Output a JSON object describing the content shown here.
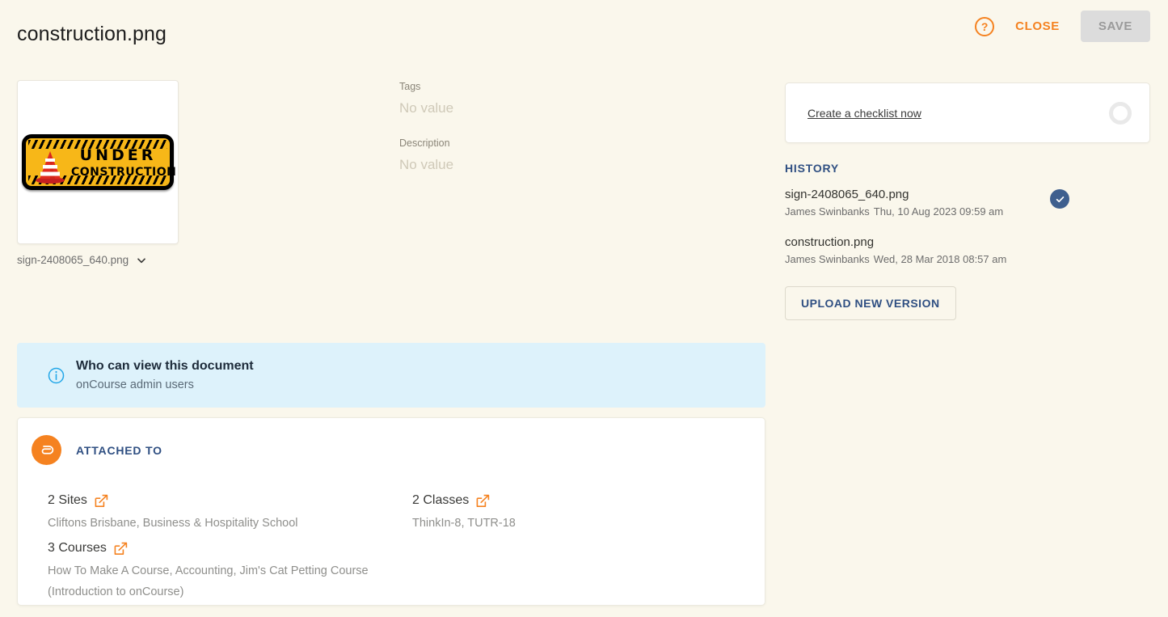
{
  "header": {
    "title": "construction.png",
    "help_icon": "help-circle-icon",
    "help_glyph": "?",
    "close_label": "CLOSE",
    "save_label": "SAVE"
  },
  "preview": {
    "sign_line1": "UNDER",
    "sign_line2": "CONSTRUCTION",
    "caption": "sign-2408065_640.png",
    "caption_chevron": "chevron-down-icon"
  },
  "meta": {
    "tags": {
      "label": "Tags",
      "value": "No value"
    },
    "description": {
      "label": "Description",
      "value": "No value"
    }
  },
  "checklist": {
    "link_label": "Create a checklist now",
    "progress_icon": "progress-ring-icon"
  },
  "history": {
    "title": "HISTORY",
    "items": [
      {
        "filename": "sign-2408065_640.png",
        "author": "James Swinbanks",
        "timestamp": "Thu, 10 Aug 2023 09:59 am",
        "current": true
      },
      {
        "filename": "construction.png",
        "author": "James Swinbanks",
        "timestamp": "Wed, 28 Mar 2018 08:57 am",
        "current": false
      }
    ],
    "upload_label": "UPLOAD NEW VERSION"
  },
  "info_banner": {
    "icon": "info-circle-icon",
    "title": "Who can view this document",
    "subtitle": "onCourse admin users"
  },
  "attached": {
    "icon": "paperclip-icon",
    "title": "ATTACHED TO",
    "groups": [
      {
        "heading": "2 Sites",
        "items": "Cliftons Brisbane, Business & Hospitality School"
      },
      {
        "heading": "2 Classes",
        "items": "ThinkIn-8, TUTR-18"
      },
      {
        "heading": "3 Courses",
        "items": "How To Make A Course, Accounting, Jim's Cat Petting Course (Introduction to onCourse)"
      }
    ]
  },
  "colors": {
    "background": "#faf7ec",
    "accent_orange": "#f58220",
    "accent_navy": "#2f4f82",
    "info_blue": "#ddf2fb",
    "muted_text": "#8f8f8c"
  }
}
